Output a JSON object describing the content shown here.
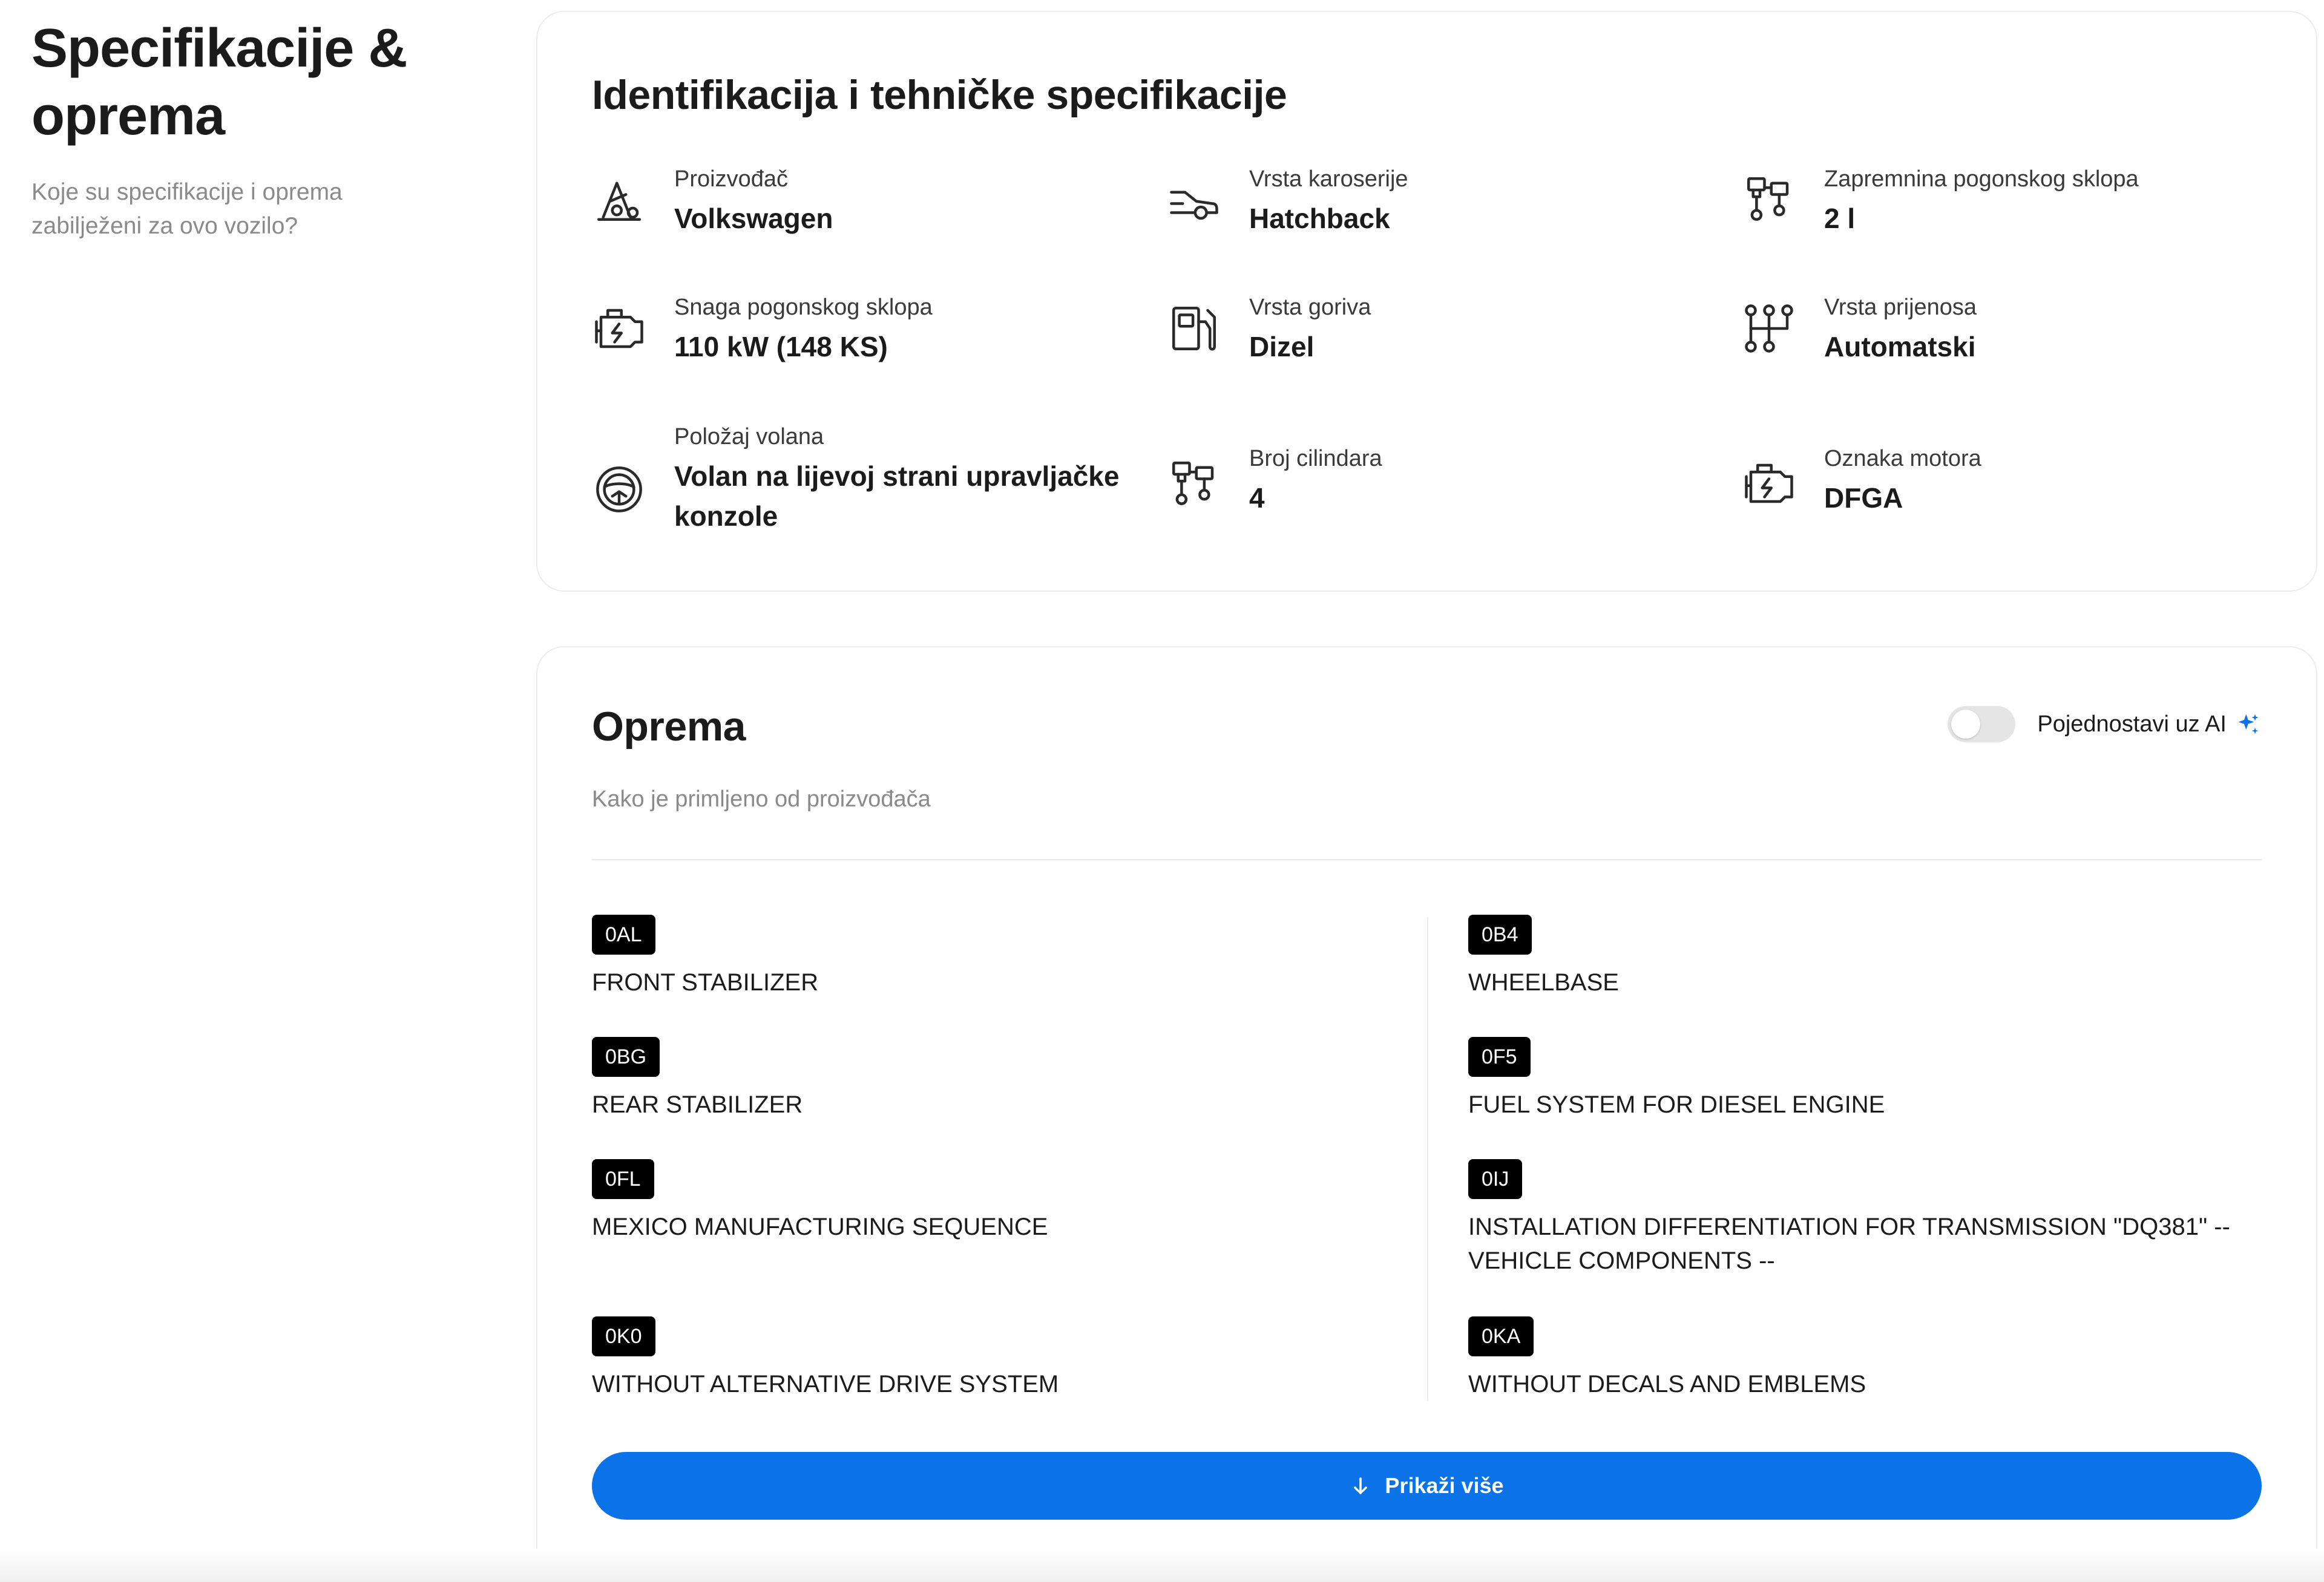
{
  "sidebar": {
    "title": "Specifikacije & oprema",
    "subtitle": "Koje su specifikacije i oprema zabilježeni za ovo vozilo?"
  },
  "specs": {
    "title": "Identifikacija i tehničke specifikacije",
    "items": [
      {
        "label": "Proizvođač",
        "value": "Volkswagen",
        "icon": "manufacturer-icon"
      },
      {
        "label": "Vrsta karoserije",
        "value": "Hatchback",
        "icon": "car-body-icon"
      },
      {
        "label": "Zapremnina pogonskog sklopa",
        "value": "2 l",
        "icon": "pistons-icon"
      },
      {
        "label": "Snaga pogonskog sklopa",
        "value": "110 kW (148 KS)",
        "icon": "engine-icon"
      },
      {
        "label": "Vrsta goriva",
        "value": "Dizel",
        "icon": "fuel-pump-icon"
      },
      {
        "label": "Vrsta prijenosa",
        "value": "Automatski",
        "icon": "gearbox-icon"
      },
      {
        "label": "Položaj volana",
        "value": "Volan na lijevoj strani upravljačke konzole",
        "icon": "steering-wheel-icon"
      },
      {
        "label": "Broj cilindara",
        "value": "4",
        "icon": "pistons-icon"
      },
      {
        "label": "Oznaka motora",
        "value": "DFGA",
        "icon": "engine-icon"
      }
    ]
  },
  "equipment": {
    "title": "Oprema",
    "subtitle": "Kako je primljeno od proizvođača",
    "toggle_label": "Pojednostavi uz AI",
    "toggle_on": false,
    "items_left": [
      {
        "code": "0AL",
        "desc": "FRONT STABILIZER"
      },
      {
        "code": "0BG",
        "desc": "REAR STABILIZER"
      },
      {
        "code": "0FL",
        "desc": "MEXICO MANUFACTURING SEQUENCE"
      },
      {
        "code": "0K0",
        "desc": "WITHOUT ALTERNATIVE DRIVE SYSTEM"
      }
    ],
    "items_right": [
      {
        "code": "0B4",
        "desc": "WHEELBASE"
      },
      {
        "code": "0F5",
        "desc": "FUEL SYSTEM FOR DIESEL ENGINE"
      },
      {
        "code": "0IJ",
        "desc": "INSTALLATION DIFFERENTIATION FOR TRANSMISSION \"DQ381\" -- VEHICLE COMPONENTS --"
      },
      {
        "code": "0KA",
        "desc": "WITHOUT DECALS AND EMBLEMS"
      }
    ],
    "show_more_label": "Prikaži više"
  },
  "colors": {
    "accent": "#0b72e7",
    "badge_bg": "#000000",
    "muted_text": "#8a8a8a"
  }
}
